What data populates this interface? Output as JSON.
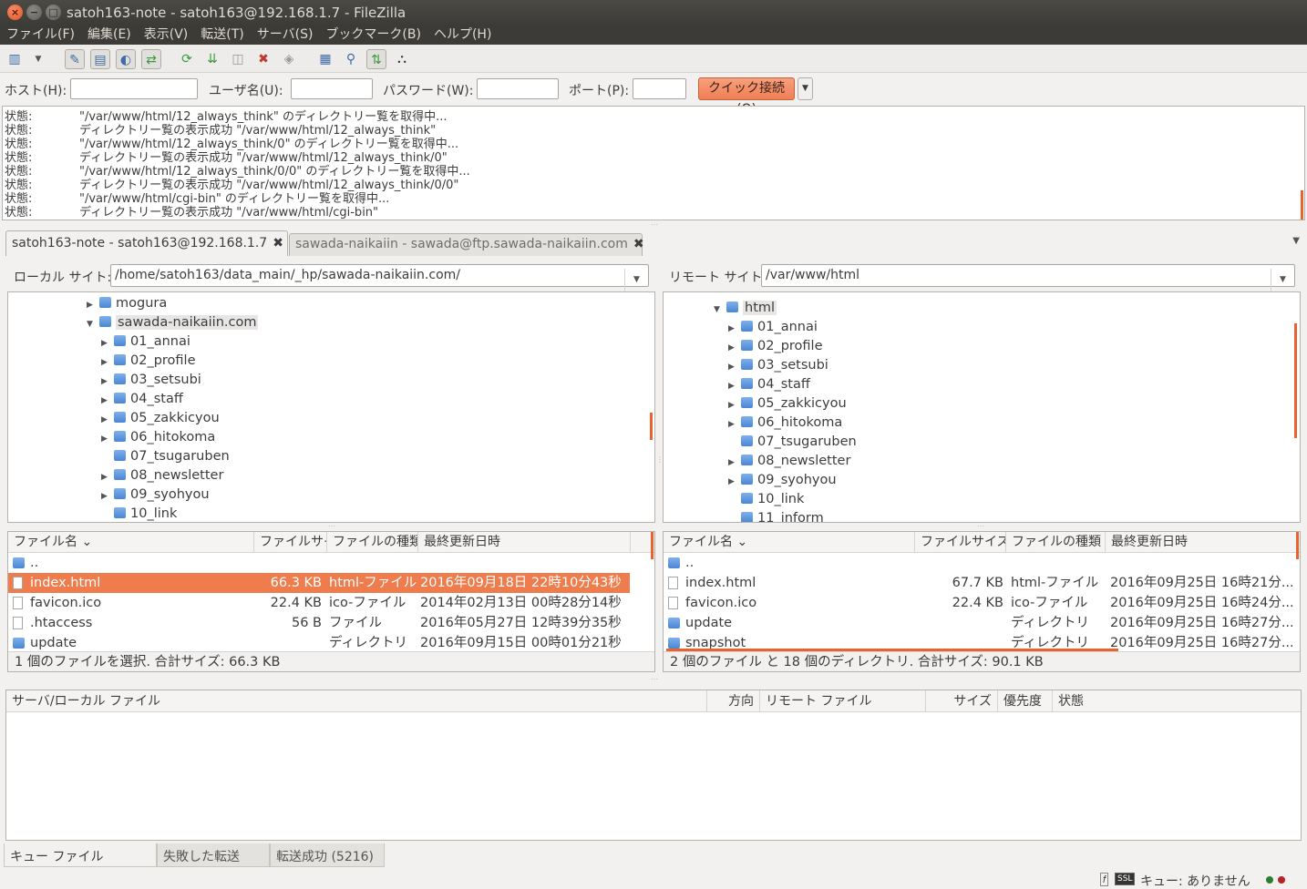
{
  "window": {
    "title": "satoh163-note - satoh163@192.168.1.7 - FileZilla",
    "close_glyph": "×",
    "min_glyph": "−",
    "max_glyph": "□"
  },
  "menu": [
    "ファイル(F)",
    "編集(E)",
    "表示(V)",
    "転送(T)",
    "サーバ(S)",
    "ブックマーク(B)",
    "ヘルプ(H)"
  ],
  "toolbar_icons": [
    "site-manager-icon",
    "dropdown-arrow-icon",
    "toggle-message-log-icon",
    "toggle-local-tree-icon",
    "toggle-remote-tree-icon",
    "toggle-transfer-queue-icon",
    "refresh-icon",
    "process-queue-icon",
    "cancel-operation-icon",
    "disconnect-icon",
    "reconnect-icon",
    "directory-comparison-icon",
    "filter-icon",
    "synchronized-browsing-icon",
    "search-remote-icon"
  ],
  "quickconnect": {
    "host_label": "ホスト(H):",
    "user_label": "ユーザ名(U):",
    "password_label": "パスワード(W):",
    "port_label": "ポート(P):",
    "button_label": "クイック接続(Q)",
    "dropdown_glyph": "▼",
    "host_value": "",
    "user_value": "",
    "password_value": "",
    "port_value": ""
  },
  "log": [
    {
      "label": "状態:",
      "text": "\"/var/www/html/12_always_think\" のディレクトリー覧を取得中..."
    },
    {
      "label": "状態:",
      "text": "ディレクトリー覧の表示成功 \"/var/www/html/12_always_think\""
    },
    {
      "label": "状態:",
      "text": "\"/var/www/html/12_always_think/0\" のディレクトリー覧を取得中..."
    },
    {
      "label": "状態:",
      "text": "ディレクトリー覧の表示成功 \"/var/www/html/12_always_think/0\""
    },
    {
      "label": "状態:",
      "text": "\"/var/www/html/12_always_think/0/0\" のディレクトリー覧を取得中..."
    },
    {
      "label": "状態:",
      "text": "ディレクトリー覧の表示成功 \"/var/www/html/12_always_think/0/0\""
    },
    {
      "label": "状態:",
      "text": "\"/var/www/html/cgi-bin\" のディレクトリー覧を取得中..."
    },
    {
      "label": "状態:",
      "text": "ディレクトリー覧の表示成功 \"/var/www/html/cgi-bin\""
    }
  ],
  "tabs": [
    {
      "label": "satoh163-note - satoh163@192.168.1.7",
      "close": "✖"
    },
    {
      "label": "sawada-naikaiin - sawada@ftp.sawada-naikaiin.com",
      "close": "✖"
    }
  ],
  "local": {
    "site_label": "ローカル サイト:",
    "path": "/home/satoh163/data_main/_hp/sawada-naikaiin.com/",
    "tree": [
      {
        "name": "mogura",
        "arrow": "▶",
        "level": 0
      },
      {
        "name": "sawada-naikaiin.com",
        "arrow": "▼",
        "level": 0
      },
      {
        "name": "01_annai",
        "arrow": "▶",
        "level": 1
      },
      {
        "name": "02_profile",
        "arrow": "▶",
        "level": 1
      },
      {
        "name": "03_setsubi",
        "arrow": "▶",
        "level": 1
      },
      {
        "name": "04_staff",
        "arrow": "▶",
        "level": 1
      },
      {
        "name": "05_zakkicyou",
        "arrow": "▶",
        "level": 1
      },
      {
        "name": "06_hitokoma",
        "arrow": "▶",
        "level": 1
      },
      {
        "name": "07_tsugaruben",
        "arrow": "",
        "level": 1
      },
      {
        "name": "08_newsletter",
        "arrow": "▶",
        "level": 1
      },
      {
        "name": "09_syohyou",
        "arrow": "▶",
        "level": 1
      },
      {
        "name": "10_link",
        "arrow": "",
        "level": 1
      }
    ],
    "columns": [
      "ファイル名",
      "ファイルサイ",
      "ファイルの種類",
      "最終更新日時"
    ],
    "sort_glyph": "⌄",
    "files": [
      {
        "name": "..",
        "size": "",
        "type": "",
        "date": "",
        "kind": "folder"
      },
      {
        "name": "index.html",
        "size": "66.3 KB",
        "type": "html-ファイル",
        "date": "2016年09月18日 22時10分43秒",
        "kind": "file"
      },
      {
        "name": "favicon.ico",
        "size": "22.4 KB",
        "type": "ico-ファイル",
        "date": "2014年02月13日 00時28分14秒",
        "kind": "file"
      },
      {
        "name": ".htaccess",
        "size": "56 B",
        "type": "ファイル",
        "date": "2016年05月27日 12時39分35秒",
        "kind": "file"
      },
      {
        "name": "update",
        "size": "",
        "type": "ディレクトリ",
        "date": "2016年09月15日 00時01分21秒",
        "kind": "folder"
      }
    ],
    "status": "1 個のファイルを選択. 合計サイズ: 66.3 KB"
  },
  "remote": {
    "site_label": "リモート サイト:",
    "path": "/var/www/html",
    "tree": [
      {
        "name": "html",
        "arrow": "▼",
        "level": 0
      },
      {
        "name": "01_annai",
        "arrow": "▶",
        "level": 1
      },
      {
        "name": "02_profile",
        "arrow": "▶",
        "level": 1
      },
      {
        "name": "03_setsubi",
        "arrow": "▶",
        "level": 1
      },
      {
        "name": "04_staff",
        "arrow": "▶",
        "level": 1
      },
      {
        "name": "05_zakkicyou",
        "arrow": "▶",
        "level": 1
      },
      {
        "name": "06_hitokoma",
        "arrow": "▶",
        "level": 1
      },
      {
        "name": "07_tsugaruben",
        "arrow": "",
        "level": 1
      },
      {
        "name": "08_newsletter",
        "arrow": "▶",
        "level": 1
      },
      {
        "name": "09_syohyou",
        "arrow": "▶",
        "level": 1
      },
      {
        "name": "10_link",
        "arrow": "",
        "level": 1
      },
      {
        "name": "11_inform",
        "arrow": "",
        "level": 1
      }
    ],
    "columns": [
      "ファイル名",
      "ファイルサイズ",
      "ファイルの種類",
      "最終更新日時"
    ],
    "sort_glyph": "⌄",
    "files": [
      {
        "name": "..",
        "size": "",
        "type": "",
        "date": "",
        "kind": "folder"
      },
      {
        "name": "index.html",
        "size": "67.7 KB",
        "type": "html-ファイル",
        "date": "2016年09月25日 16時21分...",
        "kind": "file"
      },
      {
        "name": "favicon.ico",
        "size": "22.4 KB",
        "type": "ico-ファイル",
        "date": "2016年09月25日 16時24分...",
        "kind": "file"
      },
      {
        "name": "update",
        "size": "",
        "type": "ディレクトリ",
        "date": "2016年09月25日 16時27分...",
        "kind": "folder"
      },
      {
        "name": "snapshot",
        "size": "",
        "type": "ディレクトリ",
        "date": "2016年09月25日 16時27分...",
        "kind": "folder"
      }
    ],
    "status": "2 個のファイル と 18 個のディレクトリ. 合計サイズ: 90.1 KB"
  },
  "queue": {
    "columns": [
      "サーバ/ローカル ファイル",
      "方向",
      "リモート ファイル",
      "サイズ",
      "優先度",
      "状態"
    ]
  },
  "bottom_tabs": [
    "キュー ファイル",
    "失敗した転送",
    "転送成功 (5216)"
  ],
  "statusbar": {
    "queue_text": "キュー: ありません"
  },
  "colors": {
    "accent": "#ef7c4c",
    "titlebar": "#3c3b37",
    "folder": "#4a86d4"
  }
}
